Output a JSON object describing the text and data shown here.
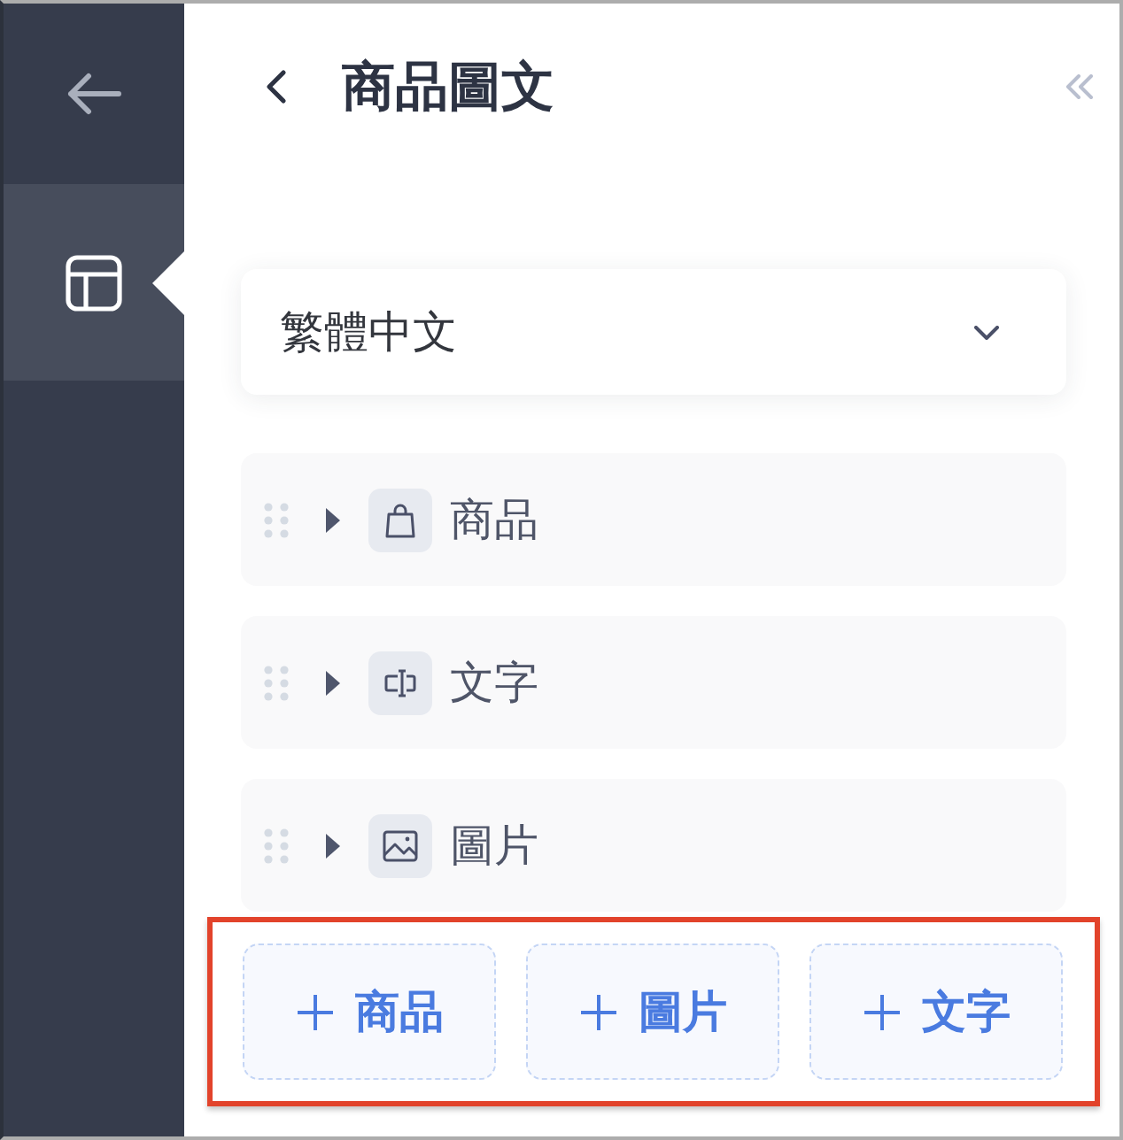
{
  "sidebar": {
    "items": [
      {
        "kind": "back",
        "selected": false
      },
      {
        "kind": "layout",
        "selected": true
      }
    ]
  },
  "header": {
    "title": "商品圖文"
  },
  "language_select": {
    "value": "繁體中文"
  },
  "blocks": [
    {
      "kind": "product",
      "label": "商品",
      "expanded": false
    },
    {
      "kind": "text",
      "label": "文字",
      "expanded": false
    },
    {
      "kind": "image",
      "label": "圖片",
      "expanded": false
    }
  ],
  "footer": {
    "highlighted": true,
    "buttons": [
      {
        "label": "商品"
      },
      {
        "label": "圖片"
      },
      {
        "label": "文字"
      }
    ]
  }
}
